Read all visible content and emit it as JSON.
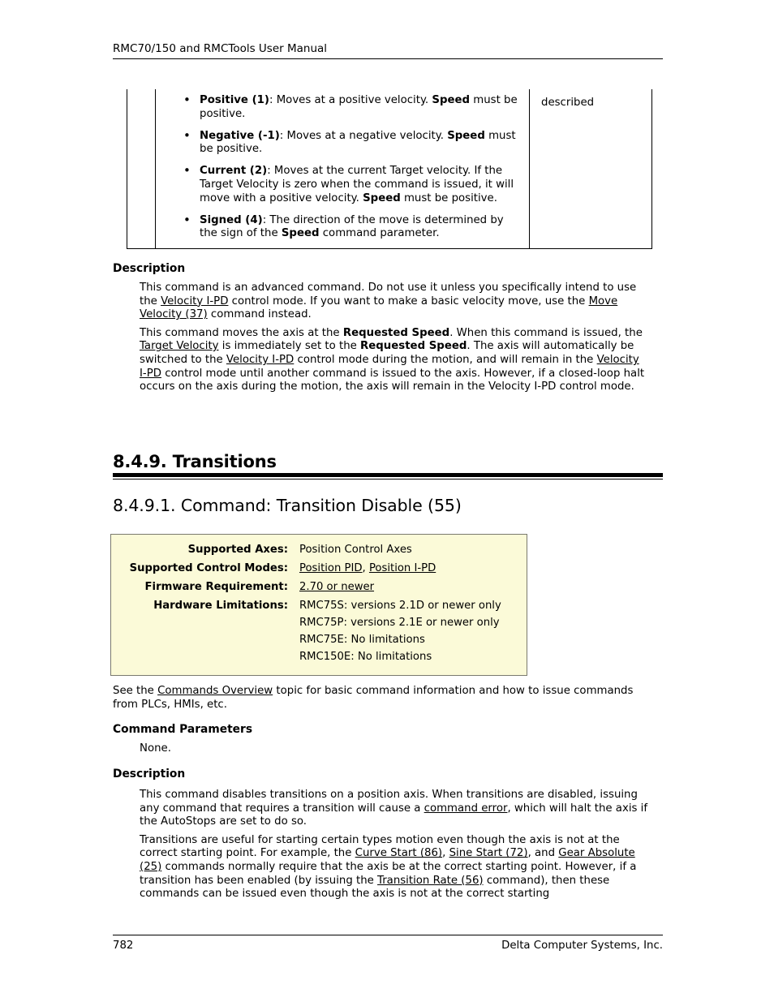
{
  "header": {
    "title": "RMC70/150 and RMCTools User Manual"
  },
  "continued_table": {
    "right_cell": "described",
    "bullets": [
      {
        "term": "Positive (1)",
        "text_parts": [
          {
            "t": ": Moves at a positive velocity. ",
            "bold": false
          },
          {
            "t": "Speed",
            "bold": true
          },
          {
            "t": " must be positive.",
            "bold": false
          }
        ]
      },
      {
        "term": "Negative (-1)",
        "text_parts": [
          {
            "t": ": Moves at a negative velocity. ",
            "bold": false
          },
          {
            "t": "Speed",
            "bold": true
          },
          {
            "t": " must be positive.",
            "bold": false
          }
        ]
      },
      {
        "term": "Current (2)",
        "text_parts": [
          {
            "t": ": Moves at the current Target velocity. If the Target Velocity is zero when the command is issued, it will move with a positive velocity. ",
            "bold": false
          },
          {
            "t": "Speed",
            "bold": true
          },
          {
            "t": " must be positive.",
            "bold": false
          }
        ]
      },
      {
        "term": "Signed (4)",
        "text_parts": [
          {
            "t": ": The direction of the move is determined by the sign of the ",
            "bold": false
          },
          {
            "t": "Speed",
            "bold": true
          },
          {
            "t": " command parameter.",
            "bold": false
          }
        ]
      }
    ]
  },
  "description_1": {
    "heading": "Description",
    "para_1": {
      "s1": "This command is an advanced command. Do not use it unless you specifically intend to use the ",
      "link1": "Velocity I-PD",
      "s2": " control mode. If you want to make a basic velocity move, use the ",
      "link2": "Move Velocity (37)",
      "s3": " command instead."
    },
    "para_2": {
      "s1": "This command moves the axis at the ",
      "b1": "Requested Speed",
      "s2": ". When this command is issued, the ",
      "link1": "Target Velocity",
      "s3": " is immediately set to the ",
      "b2": "Requested Speed",
      "s4": ". The axis will automatically be switched to the ",
      "link2": "Velocity I-PD",
      "s5": " control mode during the motion, and will remain in the ",
      "link3": "Velocity I-PD",
      "s6": " control mode until another command is issued to the axis. However, if a closed-loop halt occurs on the axis during the motion, the axis will remain in the Velocity I-PD control mode."
    }
  },
  "chapter": {
    "title": "8.4.9. Transitions"
  },
  "section": {
    "title": "8.4.9.1. Command: Transition Disable (55)"
  },
  "info_box": {
    "rows": [
      {
        "label": "Supported Axes:",
        "values": [
          {
            "text": "Position Control Axes",
            "link": false
          }
        ]
      },
      {
        "label": "Supported Control Modes:",
        "values": [
          {
            "text": "Position PID, Position I-PD",
            "link": true,
            "parts": [
              "Position PID",
              ", ",
              "Position I-PD"
            ]
          }
        ]
      },
      {
        "label": "Firmware Requirement:",
        "values": [
          {
            "text": "2.70 or newer",
            "link": true
          }
        ]
      },
      {
        "label": "Hardware Limitations:",
        "values": [
          {
            "text": "RMC75S: versions 2.1D or newer only",
            "link": false
          },
          {
            "text": "RMC75P: versions 2.1E or newer only",
            "link": false
          },
          {
            "text": "RMC75E: No limitations",
            "link": false
          },
          {
            "text": "RMC150E: No limitations",
            "link": false
          }
        ]
      }
    ]
  },
  "see_also": {
    "s1": "See the ",
    "link1": "Commands Overview",
    "s2": " topic for basic command information and how to issue commands from PLCs, HMIs, etc."
  },
  "command_parameters": {
    "heading": "Command Parameters",
    "value": "None."
  },
  "description_2": {
    "heading": "Description",
    "para_1": {
      "s1": "This command disables transitions on a position axis. When transitions are disabled, issuing any command that requires a transition will cause a ",
      "link1": "command error",
      "s2": ", which will halt the axis if the AutoStops are set to do so."
    },
    "para_2": {
      "s1": "Transitions are useful for starting certain types motion even though the axis is not at the correct starting point. For example, the ",
      "link1": "Curve Start (86)",
      "s2": ", ",
      "link2": "Sine Start (72)",
      "s3": ", and ",
      "link3": "Gear Absolute (25)",
      "s4": " commands normally require that the axis be at the correct starting point. However, if a transition has been enabled (by issuing the ",
      "link4": "Transition Rate (56)",
      "s5": " command), then these commands can be issued even though the axis is not at the correct starting"
    }
  },
  "footer": {
    "page_number": "782",
    "company": "Delta Computer Systems, Inc."
  }
}
